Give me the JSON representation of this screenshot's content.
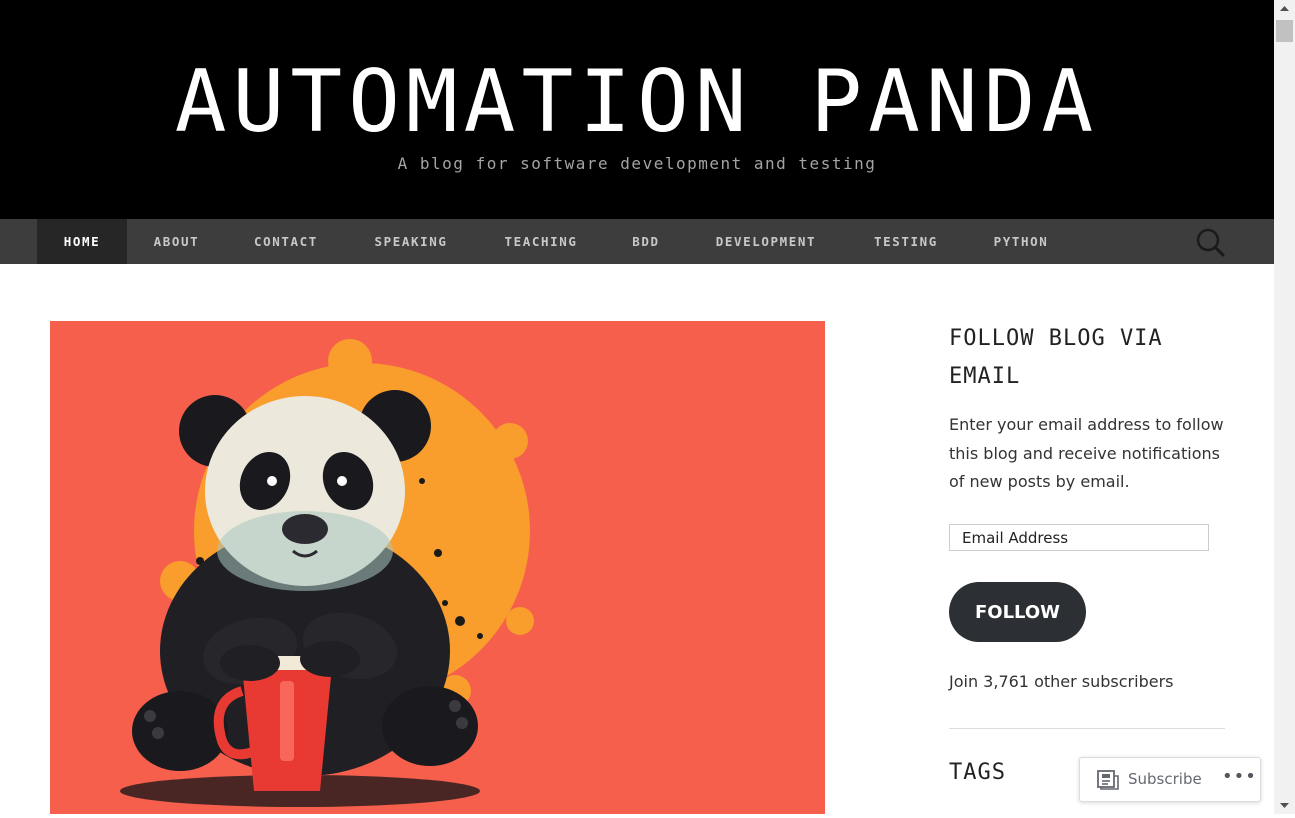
{
  "site": {
    "title": "AUTOMATION PANDA",
    "tagline": "A blog for software development and testing"
  },
  "nav": {
    "items": [
      {
        "label": "HOME",
        "active": true
      },
      {
        "label": "ABOUT"
      },
      {
        "label": "CONTACT"
      },
      {
        "label": "SPEAKING"
      },
      {
        "label": "TEACHING"
      },
      {
        "label": "BDD"
      },
      {
        "label": "DEVELOPMENT"
      },
      {
        "label": "TESTING"
      },
      {
        "label": "PYTHON"
      }
    ],
    "search_icon": "search-icon"
  },
  "hero": {
    "image": "panda-with-coffee-cup-illustration",
    "colors": {
      "background": "#f55f4c",
      "splash": "#f99d2d",
      "cup": "#e83a33"
    }
  },
  "sidebar": {
    "follow_title": "FOLLOW BLOG VIA EMAIL",
    "follow_text": "Enter your email address to follow this blog and receive notifications of new posts by email.",
    "email_placeholder": "Email Address",
    "follow_button": "FOLLOW",
    "subscribers": "Join 3,761 other subscribers",
    "tags_title": "TAGS"
  },
  "subscribe_bar": {
    "label": "Subscribe",
    "icon": "reader-icon",
    "more": "•••"
  },
  "colors": {
    "masthead": "#000000",
    "nav": "#3d3d3d",
    "nav_active": "#262626",
    "button": "#2c2f33"
  }
}
